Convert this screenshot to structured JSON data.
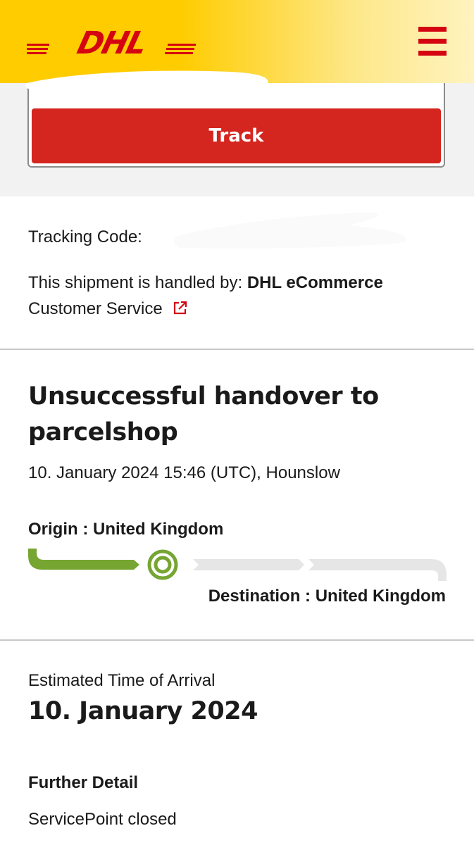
{
  "header": {
    "logo_text": "DHL",
    "menu_icon": "hamburger-menu-icon",
    "brand_yellow": "#ffcc00",
    "brand_red": "#d40511"
  },
  "search": {
    "track_button_label": "Track",
    "button_color": "#d4251e"
  },
  "shipment": {
    "tracking_code_label": "Tracking Code:",
    "handled_by_label": "This shipment is handled by:",
    "handled_by_company": "DHL eCommerce",
    "customer_service_label": "Customer Service",
    "external_link_icon": "external-link-icon"
  },
  "status": {
    "title": "Unsuccessful handover to parcelshop",
    "timestamp": "10. January 2024 15:46 (UTC), Hounslow",
    "origin": "Origin : United Kingdom",
    "destination": "Destination : United Kingdom",
    "progress_step": 2,
    "progress_total_steps": 4,
    "progress_done_color": "#76a532",
    "progress_pending_color": "#e6e6e6"
  },
  "eta": {
    "label": "Estimated Time of Arrival",
    "date": "10. January 2024"
  },
  "further_detail": {
    "label": "Further Detail",
    "value": "ServicePoint closed"
  }
}
